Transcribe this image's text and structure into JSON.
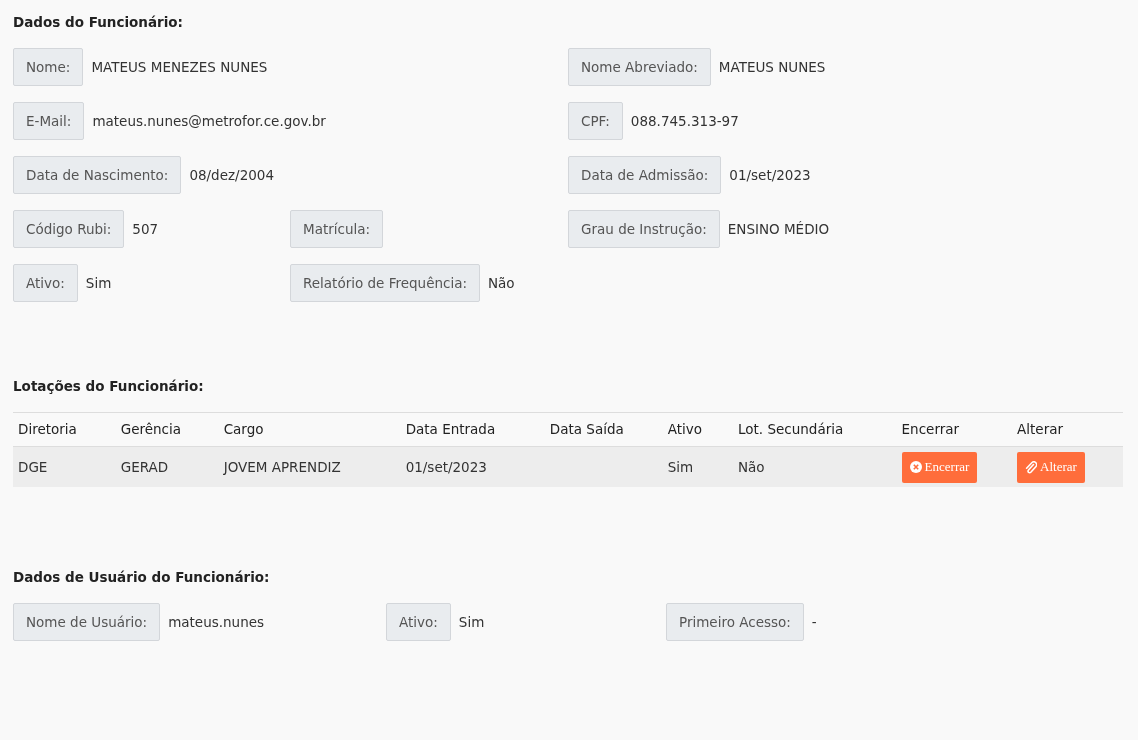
{
  "employee": {
    "title": "Dados do Funcionário:",
    "rows": [
      {
        "left": {
          "label": "Nome:",
          "value": "MATEUS MENEZES NUNES"
        },
        "right": {
          "label": "Nome Abreviado:",
          "value": "MATEUS NUNES"
        }
      },
      {
        "left": {
          "label": "E-Mail:",
          "value": "mateus.nunes@metrofor.ce.gov.br"
        },
        "right": {
          "label": "CPF:",
          "value": "088.745.313-97"
        }
      },
      {
        "left": {
          "label": "Data de Nascimento:",
          "value": "08/dez/2004"
        },
        "right": {
          "label": "Data de Admissão:",
          "value": "01/set/2023"
        }
      },
      {
        "left": {
          "label": "Código Rubi:",
          "value": "507"
        },
        "middle": {
          "label": "Matrícula:"
        },
        "right": {
          "label": "Grau de Instrução:",
          "value": "ENSINO MÉDIO"
        }
      },
      {
        "left": {
          "label": "Ativo:",
          "value": "Sim"
        },
        "middle": {
          "label": "Relatório de Frequência:",
          "value": "Não"
        }
      }
    ]
  },
  "assignments": {
    "title": "Lotações do Funcionário:",
    "table": {
      "columns": [
        "Diretoria",
        "Gerência",
        "Cargo",
        "Data Entrada",
        "Data Saída",
        "Ativo",
        "Lot. Secundária",
        "Encerrar",
        "Alterar"
      ],
      "rows": [
        {
          "cells": [
            "DGE",
            "GERAD",
            "JOVEM APRENDIZ",
            "01/set/2023",
            "",
            "Sim",
            "Não"
          ],
          "actions": [
            {
              "kind": "close",
              "label": "Encerrar"
            },
            {
              "kind": "edit",
              "label": "Alterar"
            }
          ]
        }
      ]
    }
  },
  "user": {
    "title": "Dados de Usuário do Funcionário:",
    "fields": [
      {
        "label": "Nome de Usuário:",
        "value": "mateus.nunes"
      },
      {
        "label": "Ativo:",
        "value": "Sim"
      },
      {
        "label": "Primeiro Acesso:",
        "value": "-"
      }
    ]
  }
}
